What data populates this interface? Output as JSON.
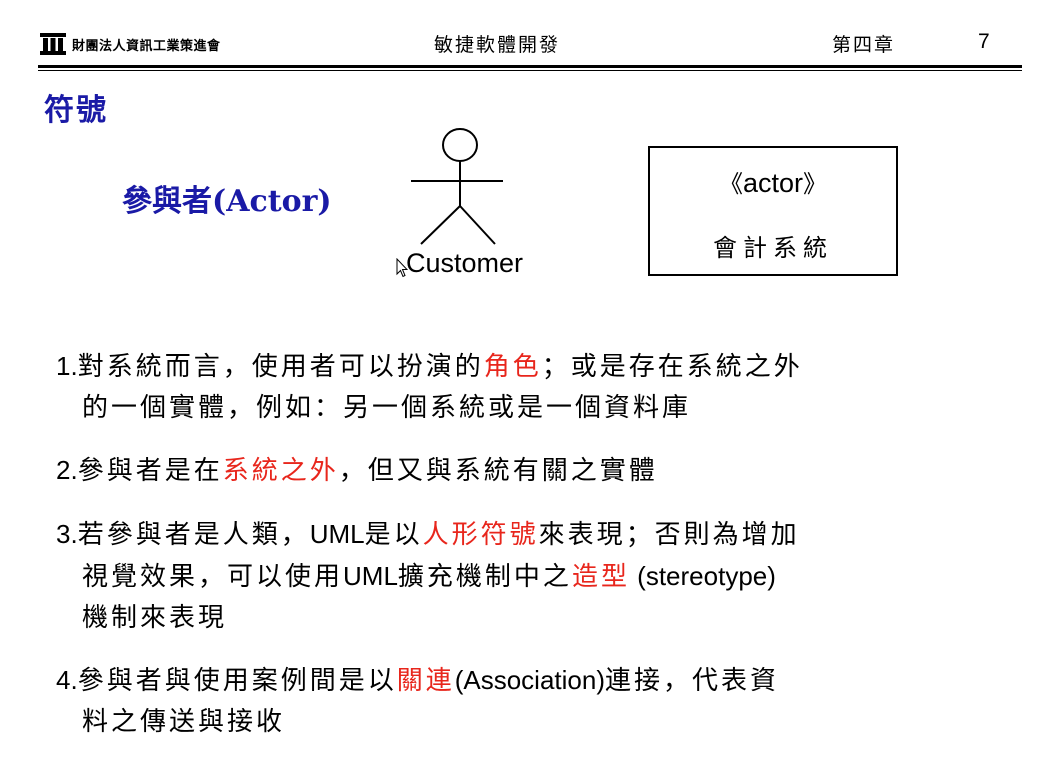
{
  "header": {
    "organization": "財團法人資訊工業策進會",
    "course_title": "敏捷軟體開發",
    "chapter": "第四章",
    "page_number": "7"
  },
  "slide": {
    "title": "符號",
    "actor_label": "參與者(Actor)",
    "stick_figure_name": "Customer",
    "stereotype_open": "《",
    "stereotype_keyword": "actor",
    "stereotype_close": "》",
    "box_actor_name": "會計系統"
  },
  "items": [
    {
      "num": "1.",
      "l1a": "對系統而言，使用者可以扮演的",
      "l1red": "角色",
      "l1b": "；或是存在系統之外",
      "l2": "的一個實體，例如：另一個系統或是一個資料庫"
    },
    {
      "num": "2.",
      "a": "參與者是在",
      "red": "系統之外",
      "b": "，但又與系統有關之實體"
    },
    {
      "num": "3.",
      "l1a": "若參與者是人類，",
      "l1uml": "UML",
      "l1b": "是以",
      "l1red": "人形符號",
      "l1c": "來表現；否則為增加",
      "l2a": "視覺效果，可以使用",
      "l2uml": "UML",
      "l2b": "擴充機制中之",
      "l2red": "造型",
      "l2latin": " (stereotype)",
      "l3": "機制來表現"
    },
    {
      "num": "4.",
      "l1a": "參與者與使用案例間是以",
      "l1red": "關連",
      "l1latin": "(Association)",
      "l1b": "連接，代表資",
      "l2": "料之傳送與接收"
    }
  ],
  "colors": {
    "title_blue": "#1a1aa6",
    "highlight_red": "#e8261c",
    "text": "#000000"
  },
  "icons": {
    "org_logo": "building-columns-icon",
    "cursor": "mouse-pointer-icon",
    "actor_figure": "stick-figure-icon"
  }
}
